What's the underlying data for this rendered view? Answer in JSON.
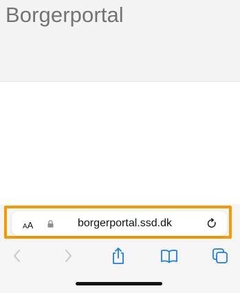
{
  "page": {
    "site_title": "Borgerportal"
  },
  "address_bar": {
    "text_size_small": "A",
    "text_size_large": "A",
    "url": "borgerportal.ssd.dk",
    "secure": true
  },
  "toolbar": {
    "back_enabled": false,
    "forward_enabled": false,
    "buttons": [
      "back-icon",
      "forward-icon",
      "share-icon",
      "bookmarks-icon",
      "tabs-icon"
    ]
  },
  "colors": {
    "accent_highlight": "#f59a00",
    "toolbar_icon": "#1a7cf5",
    "disabled_icon": "#c7c7cc",
    "title_gray": "#737373"
  }
}
